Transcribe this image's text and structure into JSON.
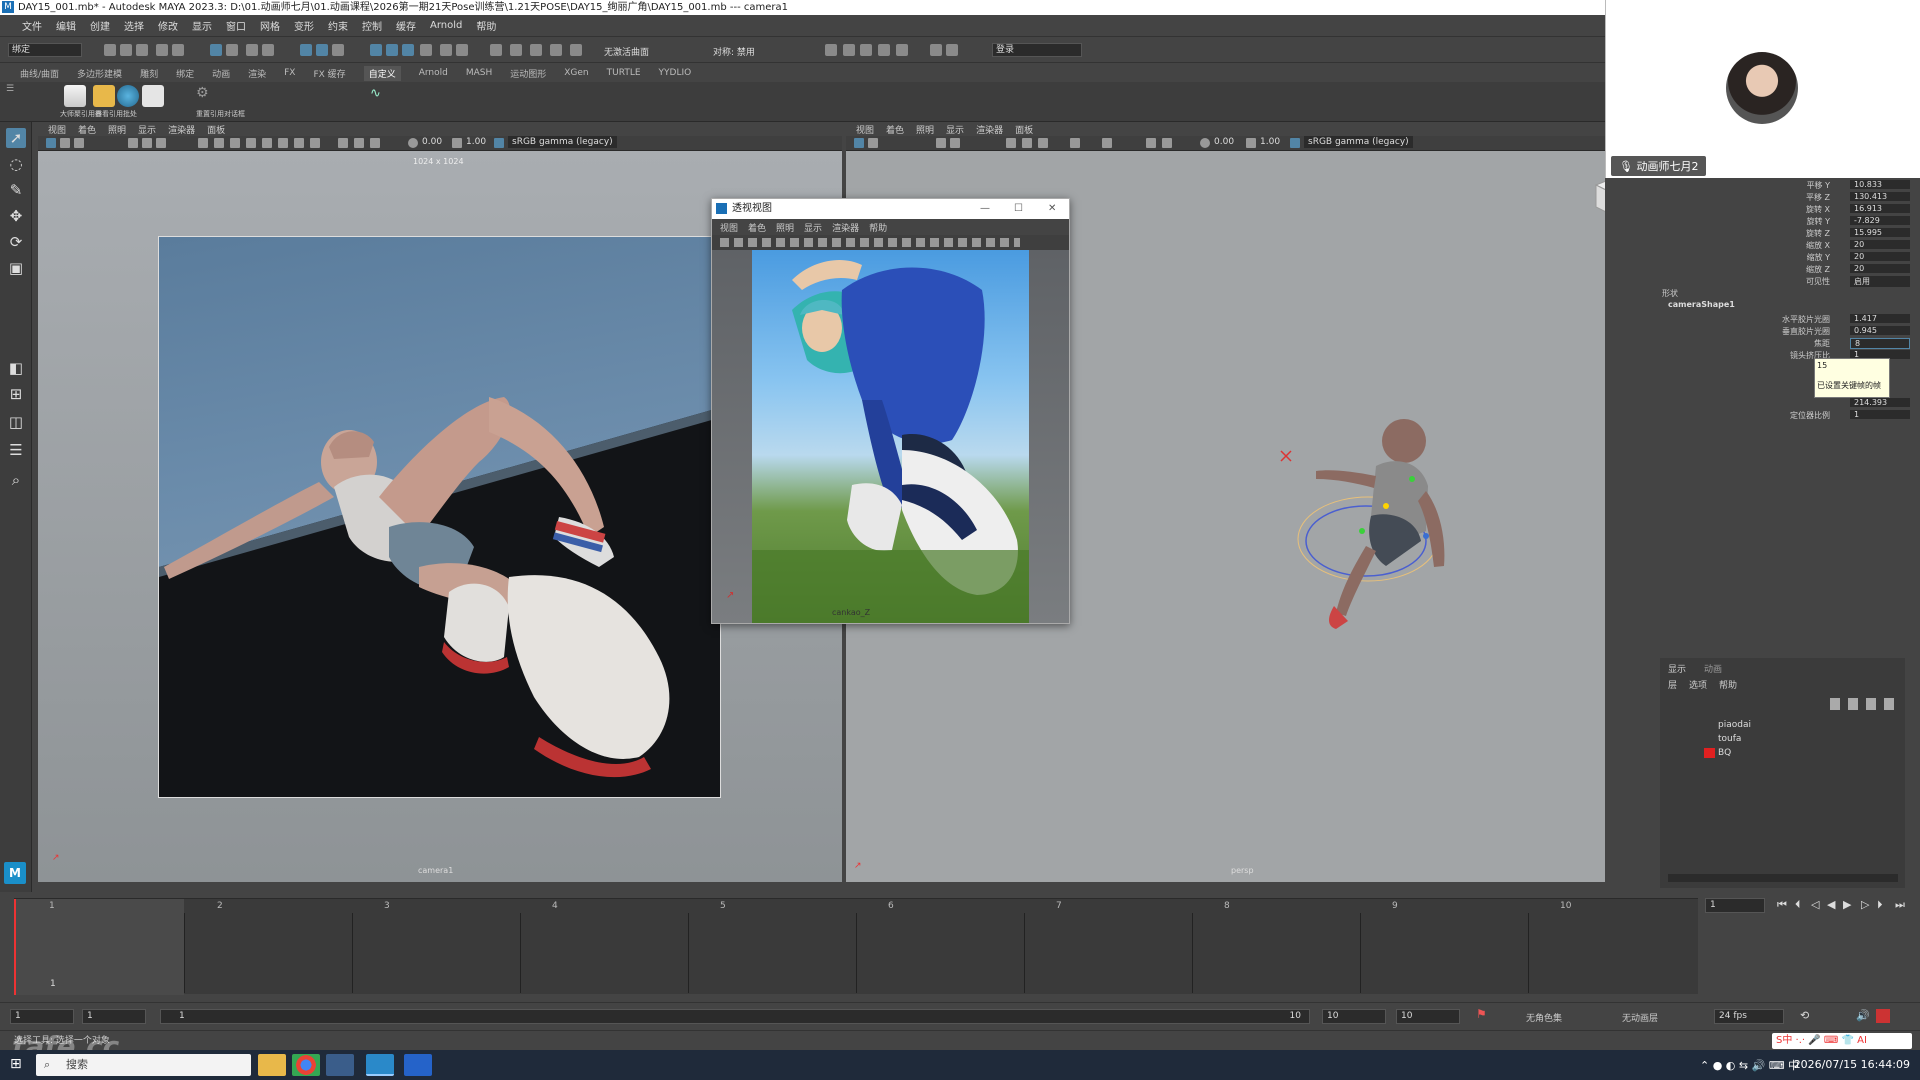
{
  "window": {
    "title": "DAY15_001.mb* - Autodesk MAYA 2023.3: D:\\01.动画师七月\\01.动画课程\\2026第一期21天Pose训练营\\1.21天POSE\\DAY15_绚丽广角\\DAY15_001.mb   ---   camera1"
  },
  "menubar": [
    "文件",
    "编辑",
    "创建",
    "选择",
    "修改",
    "显示",
    "窗口",
    "网格",
    "变形",
    "约束",
    "控制",
    "缓存",
    "Arnold",
    "帮助"
  ],
  "statusline": {
    "mode": "绑定",
    "surface": "无激活曲面",
    "symmetry": "对称: 禁用",
    "login": "登录"
  },
  "shelf_tabs": [
    "曲线/曲面",
    "多边形建模",
    "雕刻",
    "绑定",
    "动画",
    "渲染",
    "FX",
    "FX 缓存",
    "自定义",
    "Arnold",
    "MASH",
    "运动图形",
    "XGen",
    "TURTLE",
    "YYDLIO"
  ],
  "shelf_active": "自定义",
  "shelf_buttons": [
    "大师聚引用器",
    "查看引用批处",
    "重置引用对话框",
    "打开参考",
    "相机",
    "照片",
    "曲线"
  ],
  "viewport_menu": [
    "视图",
    "着色",
    "照明",
    "显示",
    "渲染器",
    "面板"
  ],
  "viewport_left": {
    "resolution": "1024 x 1024",
    "camera": "camera1",
    "exposure": "0.00",
    "gamma": "1.00",
    "colorspace": "sRGB gamma (legacy)"
  },
  "viewport_right": {
    "camera": "persp",
    "exposure": "0.00",
    "gamma": "1.00",
    "colorspace": "sRGB gamma (legacy)"
  },
  "ref_window": {
    "title": "透视视图",
    "menu": [
      "视图",
      "着色",
      "照明",
      "显示",
      "渲染器",
      "帮助"
    ],
    "caption": "cankao_Z"
  },
  "channel_box": {
    "rows": [
      {
        "k": "平移 Y",
        "v": "10.833"
      },
      {
        "k": "平移 Z",
        "v": "130.413"
      },
      {
        "k": "旋转 X",
        "v": "16.913"
      },
      {
        "k": "旋转 Y",
        "v": "-7.829"
      },
      {
        "k": "旋转 Z",
        "v": "15.995"
      },
      {
        "k": "缩放 X",
        "v": "20"
      },
      {
        "k": "缩放 Y",
        "v": "20"
      },
      {
        "k": "缩放 Z",
        "v": "20"
      },
      {
        "k": "可见性",
        "v": "启用"
      }
    ],
    "shape_header": "形状",
    "shape_name": "cameraShape1",
    "shape_rows": [
      {
        "k": "水平胶片光圈",
        "v": "1.417"
      },
      {
        "k": "垂直胶片光圈",
        "v": "0.945"
      },
      {
        "k": "焦距",
        "v": "8"
      },
      {
        "k": "镜头挤压比",
        "v": "1"
      },
      {
        "k": "",
        "v": "214.393"
      },
      {
        "k": "定位器比例",
        "v": "1"
      }
    ],
    "tooltip_value": "15",
    "tooltip_text": "已设置关键帧的帧"
  },
  "layer_panel": {
    "tabs": [
      "显示",
      "动画"
    ],
    "menu": [
      "层",
      "选项",
      "帮助"
    ],
    "layers": [
      "piaodai",
      "toufa",
      "BQ"
    ],
    "bq_color": "#e02020"
  },
  "webcam": {
    "name": "动画师七月2"
  },
  "timeline": {
    "ticks": [
      "1",
      "2",
      "3",
      "4",
      "5",
      "6",
      "7",
      "8",
      "9",
      "10"
    ],
    "current_frame": "1",
    "frame_field": "1"
  },
  "range": {
    "start": "1",
    "start2": "1",
    "slider_start": "1",
    "slider_end": "10",
    "end": "10",
    "end2": "10",
    "char_set": "无角色集",
    "anim_layer": "无动画层",
    "fps": "24 fps"
  },
  "helpline": "选择工具: 选择一个对象",
  "taskbar": {
    "search": "搜索",
    "datetime": "2026/07/15 16:44:09",
    "ime": "中"
  },
  "watermark": "tafe.cc"
}
